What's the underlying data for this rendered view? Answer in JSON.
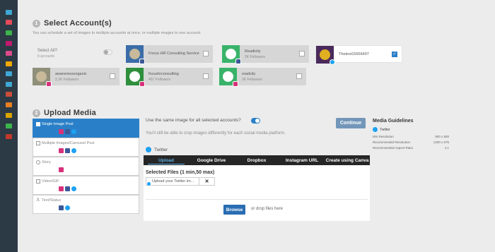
{
  "colors": {
    "sidebar": "#2c3a45",
    "accent": "#2a80c8",
    "continue": "#7296b9",
    "tab_bar": "#262626"
  },
  "sidebar": {
    "icons": [
      {
        "name": "home-icon",
        "color": "#3fa7d6"
      },
      {
        "name": "feed-icon",
        "color": "#e24b5a"
      },
      {
        "name": "calendar-icon",
        "color": "#3cb44b"
      },
      {
        "name": "image-icon",
        "color": "#c21a6e"
      },
      {
        "name": "list-icon",
        "color": "#d94b8a"
      },
      {
        "name": "chat-icon",
        "color": "#f2a900"
      },
      {
        "name": "grid-icon",
        "color": "#3fa7d6"
      },
      {
        "name": "inbox-icon",
        "color": "#3fa7d6"
      },
      {
        "name": "users-icon",
        "color": "#c94e3a"
      },
      {
        "name": "chart-icon",
        "color": "#e67e22"
      },
      {
        "name": "tag-icon",
        "color": "#d9a300"
      },
      {
        "name": "gear-icon",
        "color": "#3cb44b"
      },
      {
        "name": "alert-icon",
        "color": "#c0392b"
      }
    ]
  },
  "step1": {
    "number": "1",
    "title": "Select Account(s)",
    "subtitle": "You can schedule a set of images to multiple accounts at once, or multiple images to one account."
  },
  "select_all": {
    "label": "Select All?",
    "count": "8 accounts"
  },
  "accounts": [
    {
      "name": "Focus HR Consulting Service",
      "followers": "",
      "network": "fb",
      "checked": false
    },
    {
      "name": "Readicity",
      "followers": "2K Followers",
      "network": "fb",
      "checked": false
    },
    {
      "name": "Thetest15656497",
      "followers": "",
      "network": "tw",
      "checked": true
    },
    {
      "name": "awarenessorganic",
      "followers": "2.2K Followers",
      "network": "ig",
      "checked": false
    },
    {
      "name": "focushrconsulting",
      "followers": "457 Followers",
      "network": "ig",
      "checked": false
    },
    {
      "name": "readcity",
      "followers": "2K Followers",
      "network": "ig",
      "checked": false
    }
  ],
  "step2": {
    "number": "2",
    "title": "Upload Media"
  },
  "post_types": [
    {
      "label": "Single Image Post",
      "networks": [
        "ig",
        "fb",
        "tw"
      ]
    },
    {
      "label": "Multiple Images/Carousel Post",
      "networks": [
        "ig",
        "fb",
        "tw"
      ]
    },
    {
      "label": "Story",
      "networks": [
        "ig"
      ]
    },
    {
      "label": "Video/GIF",
      "networks": [
        "ig",
        "fb",
        "tw"
      ]
    },
    {
      "label": "Text/Status",
      "networks": [
        "fb",
        "tw"
      ]
    }
  ],
  "upload": {
    "same_image_label": "Use the same image for all selected accounts?",
    "note": "You'll still be able to crop images differently for each social media platform.",
    "network_label": "Twitter",
    "continue_label": "Continue",
    "tabs": [
      "Upload",
      "Google Drive",
      "Dropbox",
      "Instagram URL",
      "Create using Canva"
    ],
    "selected_files": "Selected Files (1 min,50 max)",
    "file_placeholder": "Upload your Twitter im...",
    "close_symbol": "✕",
    "browse_label": "Browse",
    "drop_text": "or drop files here"
  },
  "guidelines": {
    "title": "Media Guidelines",
    "network": "Twitter",
    "rows": [
      {
        "label": "Min Resolution",
        "value": "900 x 600"
      },
      {
        "label": "Recommended Resolution",
        "value": "1200 x 675"
      },
      {
        "label": "Recommended Aspect Ratio",
        "value": "1:1"
      }
    ]
  }
}
